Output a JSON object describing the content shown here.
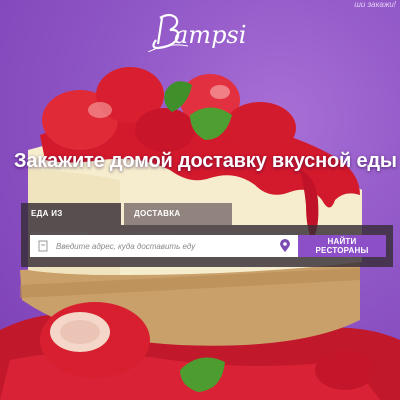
{
  "corner_text": "ши закажи!",
  "logo": {
    "text": "ampsi"
  },
  "headline": "Закажите домой доставку вкусной еды",
  "tabs": [
    {
      "label": "ЕДА ИЗ РЕСТОРАНОВ",
      "active": true
    },
    {
      "label": "ДОСТАВКА ФАСТФУДА",
      "active": false
    }
  ],
  "search": {
    "placeholder": "Введите адрес, куда доставить еду",
    "value": "",
    "button_label": "НАЙТИ РЕСТОРАНЫ"
  },
  "icons": {
    "document": "document-icon",
    "location": "map-pin-icon"
  },
  "colors": {
    "background": "#8f56c6",
    "accent": "#8c4fc7",
    "panel": "#372d37"
  }
}
